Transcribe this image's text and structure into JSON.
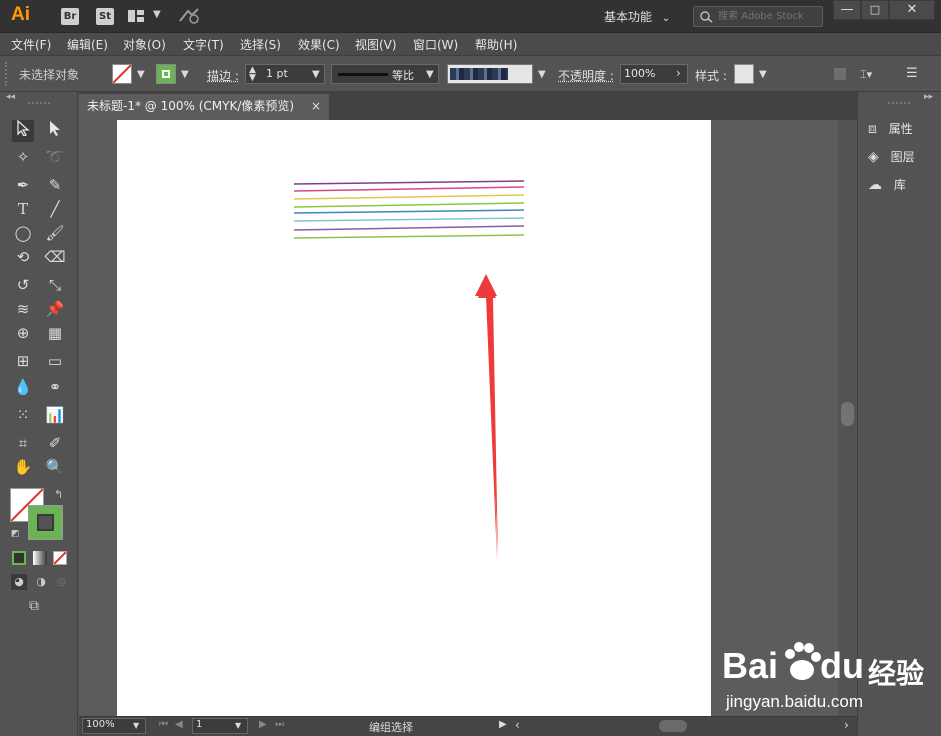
{
  "app": {
    "logo": "Ai",
    "badge_br": "Br",
    "badge_st": "St",
    "workspace": "基本功能",
    "search_placeholder": "搜索 Adobe Stock"
  },
  "window": {
    "minimize": "—",
    "maximize": "□",
    "close": "✕"
  },
  "menu": [
    "文件(F)",
    "编辑(E)",
    "对象(O)",
    "文字(T)",
    "选择(S)",
    "效果(C)",
    "视图(V)",
    "窗口(W)",
    "帮助(H)"
  ],
  "control": {
    "no_selection": "未选择对象",
    "stroke_label": "描边 :",
    "stroke_value": "1 pt",
    "profile_label": "等比",
    "opacity_label": "不透明度 :",
    "opacity_value": "100%",
    "style_label": "样式 :"
  },
  "document": {
    "tab_title": "未标题-1* @ 100% (CMYK/像素预览)",
    "tab_close": "×"
  },
  "right_panel": [
    "属性",
    "图层",
    "库"
  ],
  "status": {
    "zoom": "100%",
    "page": "1",
    "mode": "编组选择"
  },
  "colors": {
    "accent_orange": "#ff9a00",
    "fill_green": "#6cb356",
    "arrow_red": "#ee3a3a",
    "lines": [
      "#7b3f8f",
      "#d9458a",
      "#e6c84a",
      "#8ec63f",
      "#3b84c4",
      "#7fc4d6",
      "#8b5ba6",
      "#8bc34a"
    ]
  },
  "watermark": {
    "brand": "Bai",
    "brand2": "du",
    "cn": "经验",
    "url": "jingyan.baidu.com"
  }
}
